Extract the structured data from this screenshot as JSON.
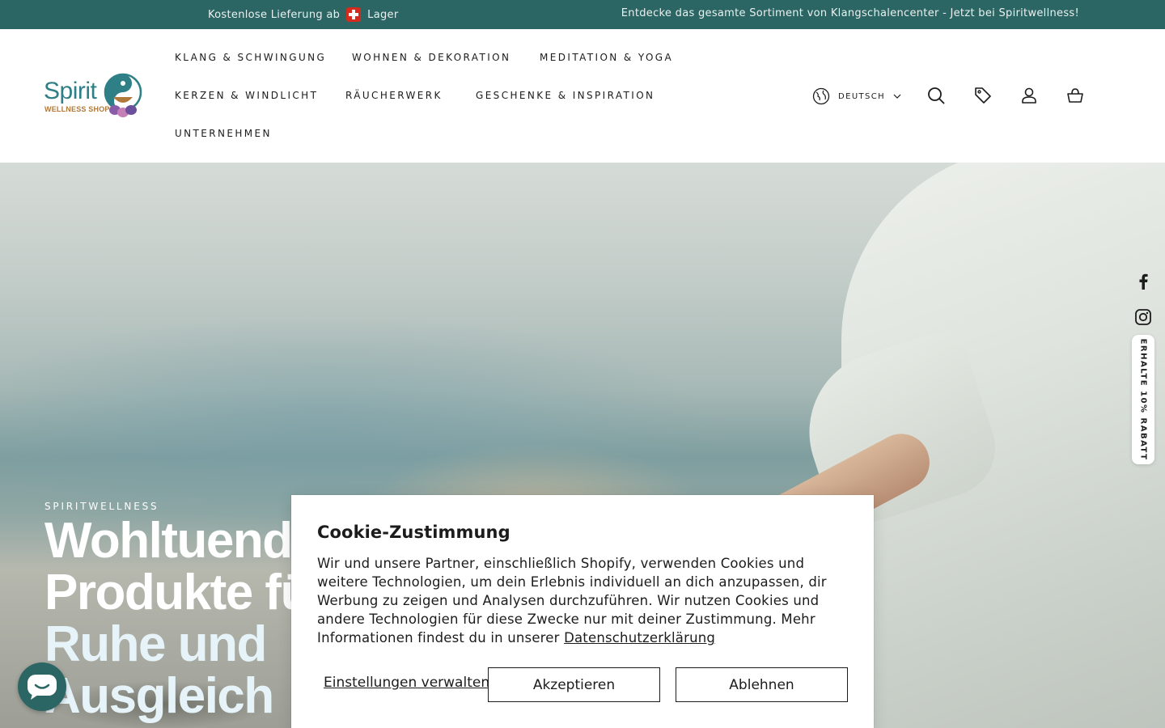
{
  "announcement": {
    "left_prefix": "Kostenlose Lieferung ab",
    "left_suffix": "Lager",
    "right": "Entdecke das gesamte Sortiment von Klangschalencenter - Jetzt bei Spiritwellness!"
  },
  "logo": {
    "text": "Spirit",
    "subtext": "WELLNESS SHOP"
  },
  "nav": {
    "items": [
      "KLANG & SCHWINGUNG",
      "WOHNEN & DEKORATION",
      "MEDITATION & YOGA",
      "KERZEN & WINDLICHT",
      "RÄUCHERWERK",
      "GESCHENKE & INSPIRATION",
      "UNTERNEHMEN"
    ]
  },
  "header": {
    "language": "DEUTSCH"
  },
  "hero": {
    "kicker": "SPIRITWELLNESS",
    "title_lines": [
      "Wohltuende",
      "Produkte fü",
      "Ruhe und",
      "Ausgleich"
    ]
  },
  "side": {
    "discount": "ERHALTE 10% RABATT"
  },
  "cookie": {
    "title": "Cookie-Zustimmung",
    "body": "Wir und unsere Partner, einschließlich Shopify, verwenden Cookies und weitere Technologien, um dein Erlebnis individuell an dich anzupassen, dir Werbung zu zeigen und Analysen durchzuführen. Wir nutzen Cookies und andere Technologien für diese Zwecke nur mit deiner Zustimmung. Mehr Informationen findest du in unserer",
    "privacy_link": "Datenschutzerklärung",
    "manage": "Einstellungen verwalten",
    "accept": "Akzeptieren",
    "decline": "Ablehnen"
  },
  "colors": {
    "brand": "#2c6664",
    "logo_blue": "#2e7f86",
    "logo_gold": "#b0793a",
    "text": "#1c1c1c"
  }
}
